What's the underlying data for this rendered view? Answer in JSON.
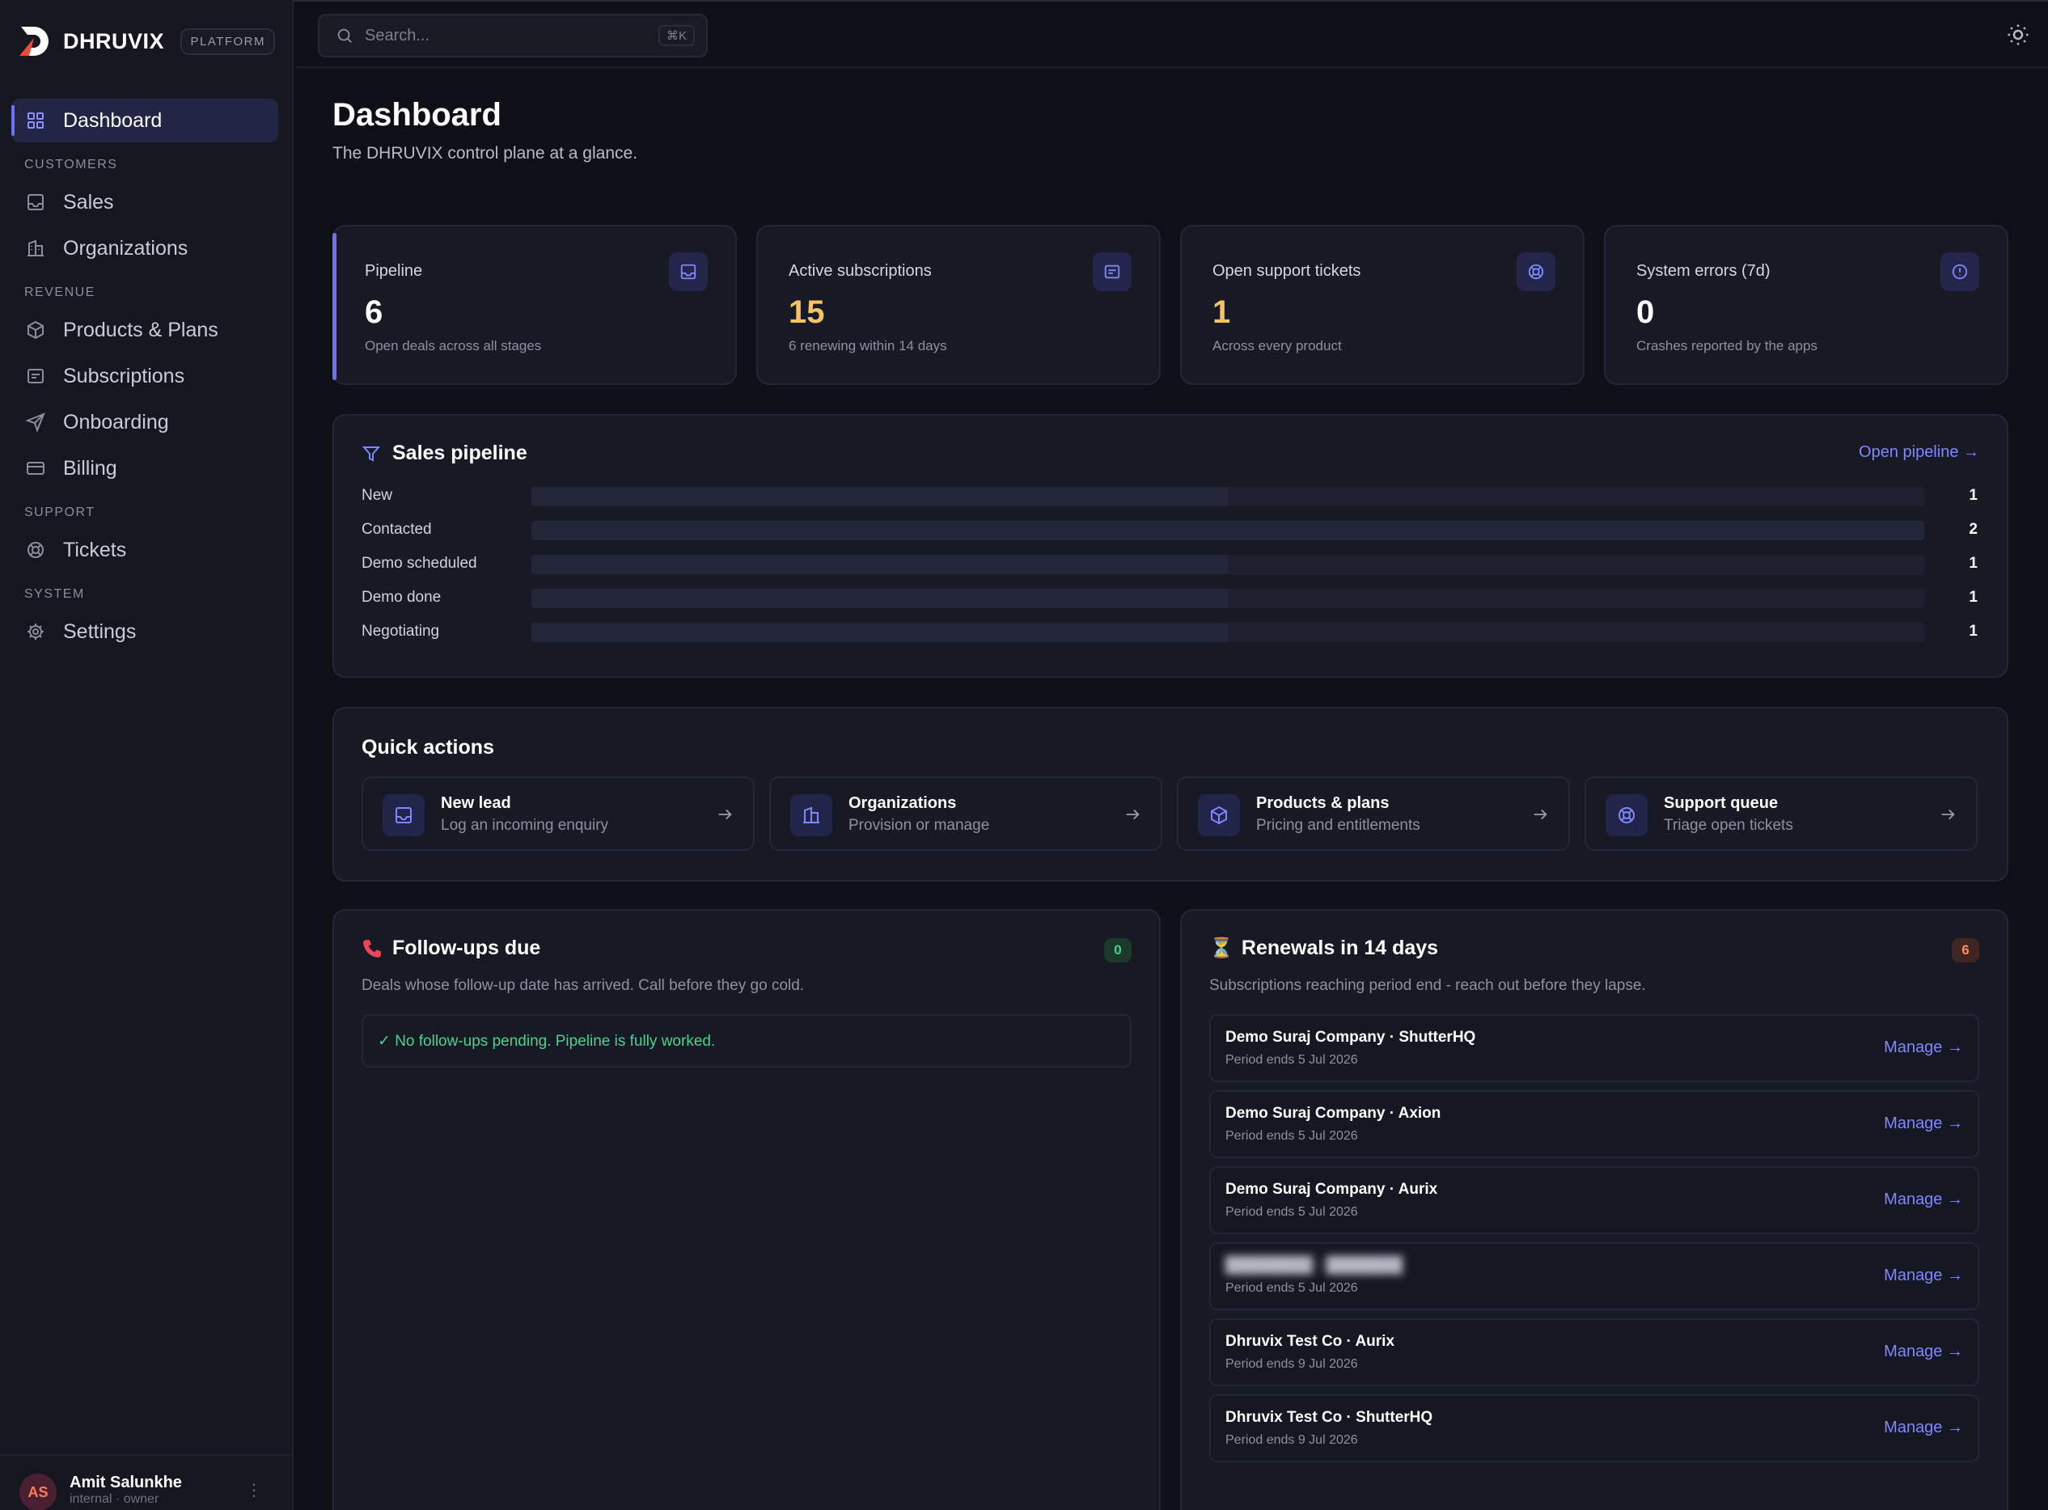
{
  "brand": {
    "name": "DHRUVIX",
    "chip": "PLATFORM"
  },
  "sidebar": {
    "dashboard": "Dashboard",
    "sections": [
      "CUSTOMERS",
      "REVENUE",
      "SUPPORT",
      "SYSTEM"
    ],
    "items": [
      {
        "label": "Sales",
        "icon": "inbox-icon"
      },
      {
        "label": "Organizations",
        "icon": "building-icon"
      },
      {
        "label": "Products & Plans",
        "icon": "box-icon"
      },
      {
        "label": "Subscriptions",
        "icon": "list-icon"
      },
      {
        "label": "Onboarding",
        "icon": "send-icon"
      },
      {
        "label": "Billing",
        "icon": "credit-card-icon"
      },
      {
        "label": "Tickets",
        "icon": "lifebuoy-icon"
      },
      {
        "label": "Settings",
        "icon": "gear-icon"
      }
    ]
  },
  "user": {
    "initials": "AS",
    "name": "Amit Salunkhe",
    "role": "internal · owner"
  },
  "search": {
    "placeholder": "Search...",
    "shortcut": "⌘K"
  },
  "page": {
    "title": "Dashboard",
    "subtitle": "The DHRUVIX control plane at a glance."
  },
  "stats": [
    {
      "label": "Pipeline",
      "value": "6",
      "sub": "Open deals across all stages"
    },
    {
      "label": "Active subscriptions",
      "value": "15",
      "sub": "6 renewing within 14 days"
    },
    {
      "label": "Open support tickets",
      "value": "1",
      "sub": "Across every product"
    },
    {
      "label": "System errors (7d)",
      "value": "0",
      "sub": "Crashes reported by the apps"
    }
  ],
  "pipeline": {
    "title": "Sales pipeline",
    "link": "Open pipeline →",
    "stages": [
      {
        "label": "New",
        "value": 1
      },
      {
        "label": "Contacted",
        "value": 2
      },
      {
        "label": "Demo scheduled",
        "value": 1
      },
      {
        "label": "Demo done",
        "value": 1
      },
      {
        "label": "Negotiating",
        "value": 1
      }
    ]
  },
  "quick_actions": {
    "title": "Quick actions",
    "items": [
      {
        "title": "New lead",
        "sub": "Log an incoming enquiry"
      },
      {
        "title": "Organizations",
        "sub": "Provision or manage"
      },
      {
        "title": "Products & plans",
        "sub": "Pricing and entitlements"
      },
      {
        "title": "Support queue",
        "sub": "Triage open tickets"
      }
    ]
  },
  "followups": {
    "title": "Follow-ups due",
    "count": "0",
    "desc": "Deals whose follow-up date has arrived. Call before they go cold.",
    "empty": "✓ No follow-ups pending. Pipeline is fully worked."
  },
  "renewals": {
    "title": "Renewals in 14 days",
    "count": "6",
    "desc": "Subscriptions reaching period end - reach out before they lapse.",
    "manage_label": "Manage →",
    "items": [
      {
        "name": "Demo Suraj Company · ShutterHQ",
        "period": "Period ends 5 Jul 2026"
      },
      {
        "name": "Demo Suraj Company · Axion",
        "period": "Period ends 5 Jul 2026"
      },
      {
        "name": "Demo Suraj Company · Aurix",
        "period": "Period ends 5 Jul 2026"
      },
      {
        "name": "████████ · ███████",
        "period": "Period ends 5 Jul 2026"
      },
      {
        "name": "Dhruvix Test Co · Aurix",
        "period": "Period ends 9 Jul 2026"
      },
      {
        "name": "Dhruvix Test Co · ShutterHQ",
        "period": "Period ends 9 Jul 2026"
      }
    ]
  },
  "colors": {
    "accent": "#6c72f2",
    "amber": "#f5c266",
    "success": "#49d28c",
    "link": "#7f87ff"
  }
}
